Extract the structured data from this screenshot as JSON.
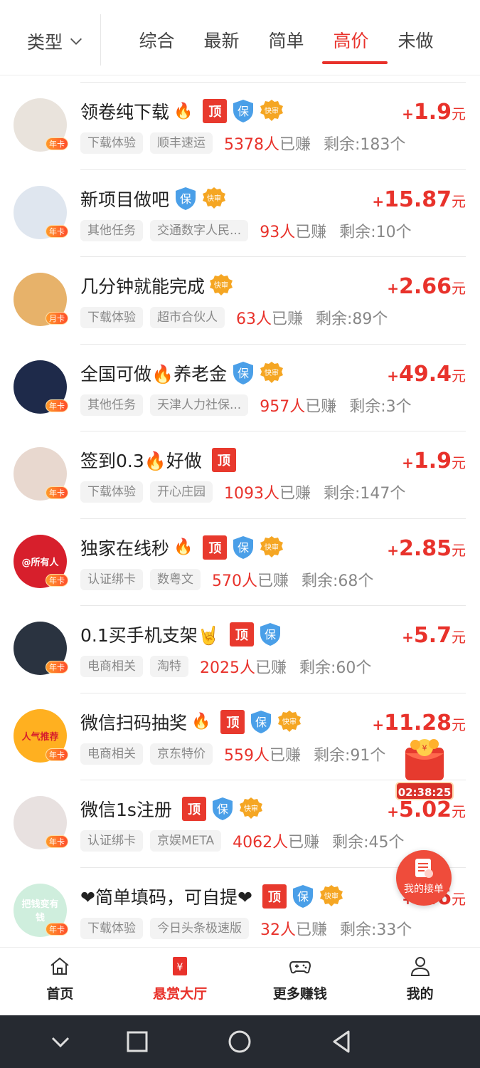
{
  "filter": {
    "type_label": "类型",
    "tabs": [
      "综合",
      "最新",
      "简单",
      "高价",
      "未做"
    ],
    "active_tab": "高价"
  },
  "tags": {
    "ding": "顶",
    "bao": "保",
    "kuai": "快审"
  },
  "items": [
    {
      "title": "领卷纯下载",
      "fire": true,
      "ding": true,
      "bao": true,
      "kuai": true,
      "price": "1.9",
      "unit": "元",
      "chip1": "下载体验",
      "chip2": "顺丰速运",
      "earned_num": "5378人",
      "earned_suffix": "已赚",
      "remain": "剩余:183个",
      "badge": "年卡"
    },
    {
      "title": "新项目做吧",
      "fire": false,
      "ding": false,
      "bao": true,
      "kuai": true,
      "price": "15.87",
      "unit": "元",
      "chip1": "其他任务",
      "chip2": "交通数字人民...",
      "earned_num": "93人",
      "earned_suffix": "已赚",
      "remain": "剩余:10个",
      "badge": "年卡"
    },
    {
      "title": "几分钟就能完成",
      "fire": false,
      "ding": false,
      "bao": false,
      "kuai": true,
      "price": "2.66",
      "unit": "元",
      "chip1": "下载体验",
      "chip2": "超市合伙人",
      "earned_num": "63人",
      "earned_suffix": "已赚",
      "remain": "剩余:89个",
      "badge": "月卡"
    },
    {
      "title": "全国可做🔥养老金",
      "fire": false,
      "ding": false,
      "bao": true,
      "kuai": true,
      "price": "49.4",
      "unit": "元",
      "chip1": "其他任务",
      "chip2": "天津人力社保...",
      "earned_num": "957人",
      "earned_suffix": "已赚",
      "remain": "剩余:3个",
      "badge": "年卡"
    },
    {
      "title": "签到0.3🔥好做",
      "fire": false,
      "ding": true,
      "bao": false,
      "kuai": false,
      "price": "1.9",
      "unit": "元",
      "chip1": "下载体验",
      "chip2": "开心庄园",
      "earned_num": "1093人",
      "earned_suffix": "已赚",
      "remain": "剩余:147个",
      "badge": "年卡"
    },
    {
      "title": "独家在线秒",
      "fire": true,
      "ding": true,
      "bao": true,
      "kuai": true,
      "price": "2.85",
      "unit": "元",
      "chip1": "认证绑卡",
      "chip2": "数粤文",
      "earned_num": "570人",
      "earned_suffix": "已赚",
      "remain": "剩余:68个",
      "badge": "年卡",
      "avatar_text": "@所有人"
    },
    {
      "title": "0.1买手机支架🤘",
      "fire": false,
      "ding": true,
      "bao": true,
      "kuai": false,
      "price": "5.7",
      "unit": "元",
      "chip1": "电商相关",
      "chip2": "淘特",
      "earned_num": "2025人",
      "earned_suffix": "已赚",
      "remain": "剩余:60个",
      "badge": "年卡"
    },
    {
      "title": "微信扫码抽奖",
      "fire": true,
      "ding": true,
      "bao": true,
      "kuai": true,
      "price": "11.28",
      "unit": "元",
      "chip1": "电商相关",
      "chip2": "京东特价",
      "earned_num": "559人",
      "earned_suffix": "已赚",
      "remain": "剩余:91个",
      "badge": "年卡",
      "avatar_text": "人气推荐"
    },
    {
      "title": "微信1s注册",
      "fire": false,
      "ding": true,
      "bao": true,
      "kuai": true,
      "price": "5.02",
      "unit": "元",
      "chip1": "认证绑卡",
      "chip2": "京娱META",
      "earned_num": "4062人",
      "earned_suffix": "已赚",
      "remain": "剩余:45个",
      "badge": "年卡"
    },
    {
      "title": "❤简单填码，可自提❤",
      "fire": false,
      "ding": true,
      "bao": true,
      "kuai": true,
      "price": "4.6",
      "unit": "元",
      "chip1": "下载体验",
      "chip2": "今日头条极速版",
      "earned_num": "32人",
      "earned_suffix": "已赚",
      "remain": "剩余:33个",
      "badge": "年卡",
      "avatar_text": "把钱变有钱"
    }
  ],
  "floating": {
    "timer": "02:38:25",
    "my_orders_label": "我的接单"
  },
  "bottom_nav": [
    {
      "label": "首页",
      "icon": "home-icon"
    },
    {
      "label": "悬赏大厅",
      "icon": "reward-hall-icon"
    },
    {
      "label": "更多赚钱",
      "icon": "gamepad-icon"
    },
    {
      "label": "我的",
      "icon": "user-icon"
    }
  ],
  "colors": {
    "accent": "#e8322b",
    "tag_red": "#e8392d",
    "shield_blue": "#4a9fe8",
    "kuai_orange": "#f5a623"
  }
}
